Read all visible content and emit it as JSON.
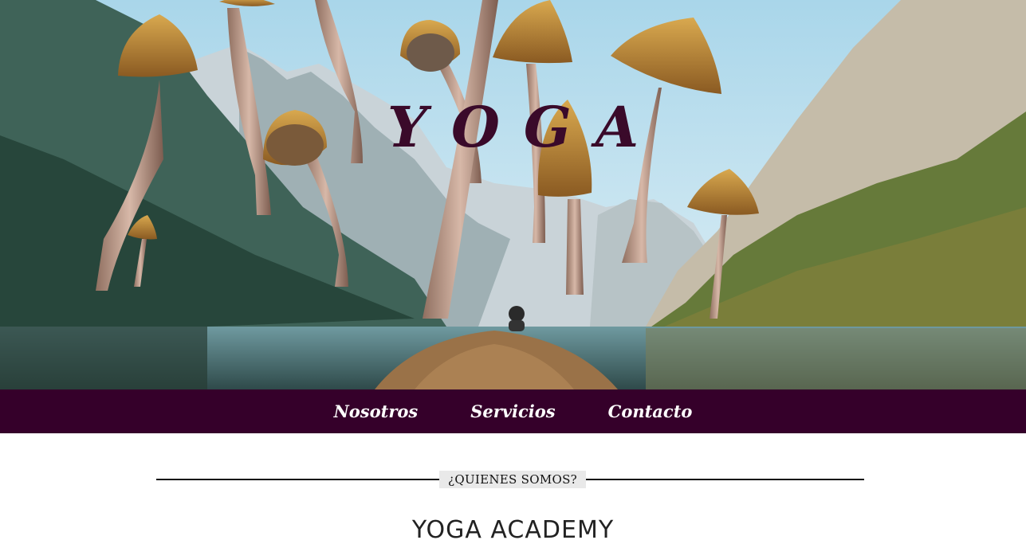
{
  "hero": {
    "title": "YOGA",
    "image": "mountain-lake-with-floating-mushrooms"
  },
  "nav": {
    "items": [
      {
        "label": "Nosotros"
      },
      {
        "label": "Servicios"
      },
      {
        "label": "Contacto"
      }
    ],
    "background": "#35002a",
    "text_color": "#ffffff"
  },
  "about": {
    "divider_label": "¿QUIENES SOMOS?",
    "title": "YOGA ACADEMY"
  },
  "colors": {
    "title_color": "#3a0a2a",
    "label_bg": "#e9e9e9"
  }
}
